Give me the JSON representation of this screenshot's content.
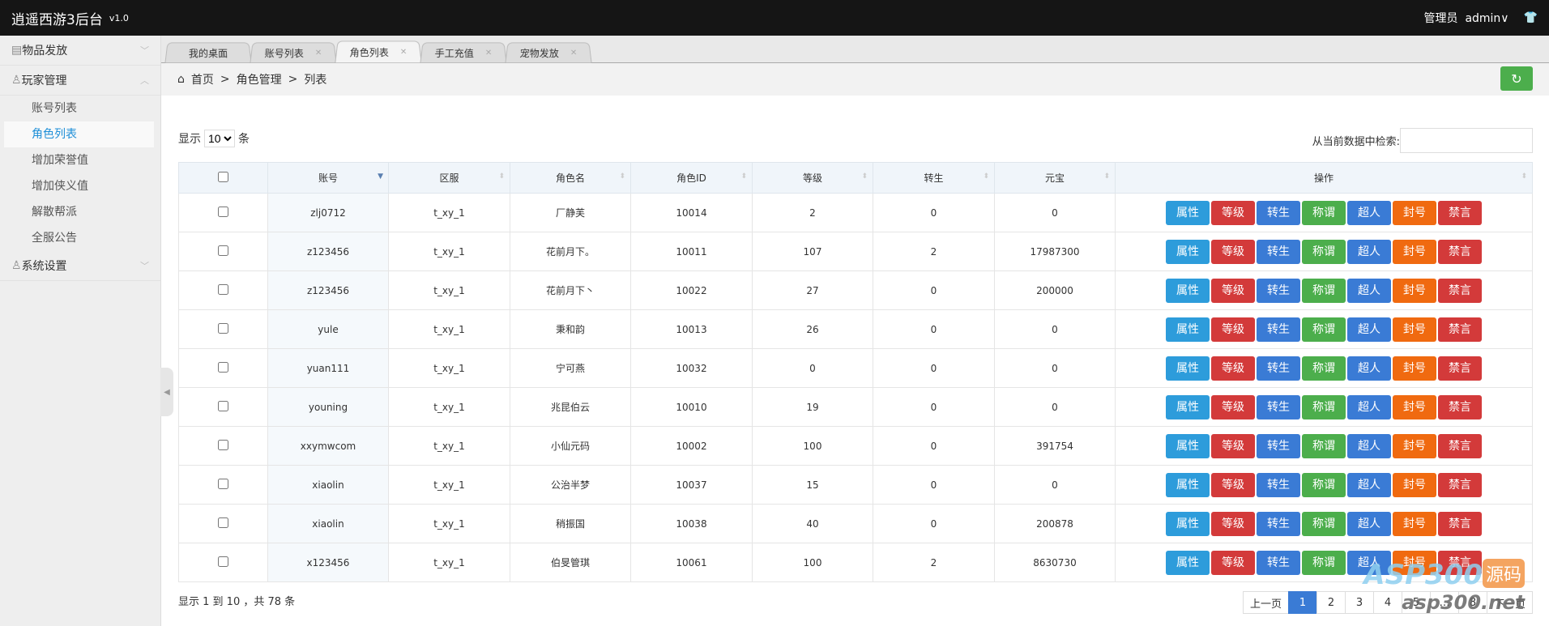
{
  "header": {
    "title": "逍遥西游3后台",
    "version": "v1.0",
    "user_label": "管理员",
    "user_name": "admin∨",
    "skin_icon": "tshirt-icon"
  },
  "sidebar": {
    "groups": [
      {
        "label": "物品发放",
        "icon": "list-icon",
        "expanded": false
      },
      {
        "label": "玩家管理",
        "icon": "user-icon",
        "expanded": true,
        "items": [
          "账号列表",
          "角色列表",
          "增加荣誉值",
          "增加侠义值",
          "解散帮派",
          "全服公告"
        ],
        "active": "角色列表"
      },
      {
        "label": "系统设置",
        "icon": "user-icon",
        "expanded": false
      }
    ]
  },
  "tabs": [
    {
      "label": "我的桌面"
    },
    {
      "label": "账号列表"
    },
    {
      "label": "角色列表",
      "active": true
    },
    {
      "label": "手工充值"
    },
    {
      "label": "宠物发放"
    }
  ],
  "breadcrumb": [
    "首页",
    "角色管理",
    "列表"
  ],
  "length": {
    "prefix": "显示",
    "value": "10",
    "suffix": "条"
  },
  "search": {
    "label": "从当前数据中检索:",
    "value": ""
  },
  "table": {
    "columns": [
      "账号",
      "区服",
      "角色名",
      "角色ID",
      "等级",
      "转生",
      "元宝",
      "操作"
    ],
    "rows": [
      [
        "zlj0712",
        "t_xy_1",
        "厂静芙",
        "10014",
        "2",
        "0",
        "0"
      ],
      [
        "z123456",
        "t_xy_1",
        "花前月下。",
        "10011",
        "107",
        "2",
        "17987300"
      ],
      [
        "z123456",
        "t_xy_1",
        "花前月下丶",
        "10022",
        "27",
        "0",
        "200000"
      ],
      [
        "yule",
        "t_xy_1",
        "秉和韵",
        "10013",
        "26",
        "0",
        "0"
      ],
      [
        "yuan111",
        "t_xy_1",
        "宁可燕",
        "10032",
        "0",
        "0",
        "0"
      ],
      [
        "youning",
        "t_xy_1",
        "兆昆伯云",
        "10010",
        "19",
        "0",
        "0"
      ],
      [
        "xxymwcom",
        "t_xy_1",
        "小仙元码",
        "10002",
        "100",
        "0",
        "391754"
      ],
      [
        "xiaolin",
        "t_xy_1",
        "公治半梦",
        "10037",
        "15",
        "0",
        "0"
      ],
      [
        "xiaolin",
        "t_xy_1",
        "稍振国",
        "10038",
        "40",
        "0",
        "200878"
      ],
      [
        "x123456",
        "t_xy_1",
        "伯旻管琪",
        "10061",
        "100",
        "2",
        "8630730"
      ]
    ],
    "actions": [
      {
        "label": "属性",
        "color": "#2d9cdb"
      },
      {
        "label": "等级",
        "color": "#d33a3a"
      },
      {
        "label": "转生",
        "color": "#3a7bd5"
      },
      {
        "label": "称谓",
        "color": "#4cae4c"
      },
      {
        "label": "超人",
        "color": "#3a7bd5"
      },
      {
        "label": "封号",
        "color": "#f06a10"
      },
      {
        "label": "禁言",
        "color": "#d33a3a"
      }
    ]
  },
  "footer": {
    "info": "显示 1 到 10 ，共 78 条",
    "prev": "上一页",
    "pages": [
      "1",
      "2",
      "3",
      "4",
      "5",
      "…",
      "8"
    ],
    "current": "1",
    "next": "下一页"
  },
  "watermark": {
    "brand": "ASP300",
    "tag": "源码",
    "domain": "asp300.net"
  }
}
